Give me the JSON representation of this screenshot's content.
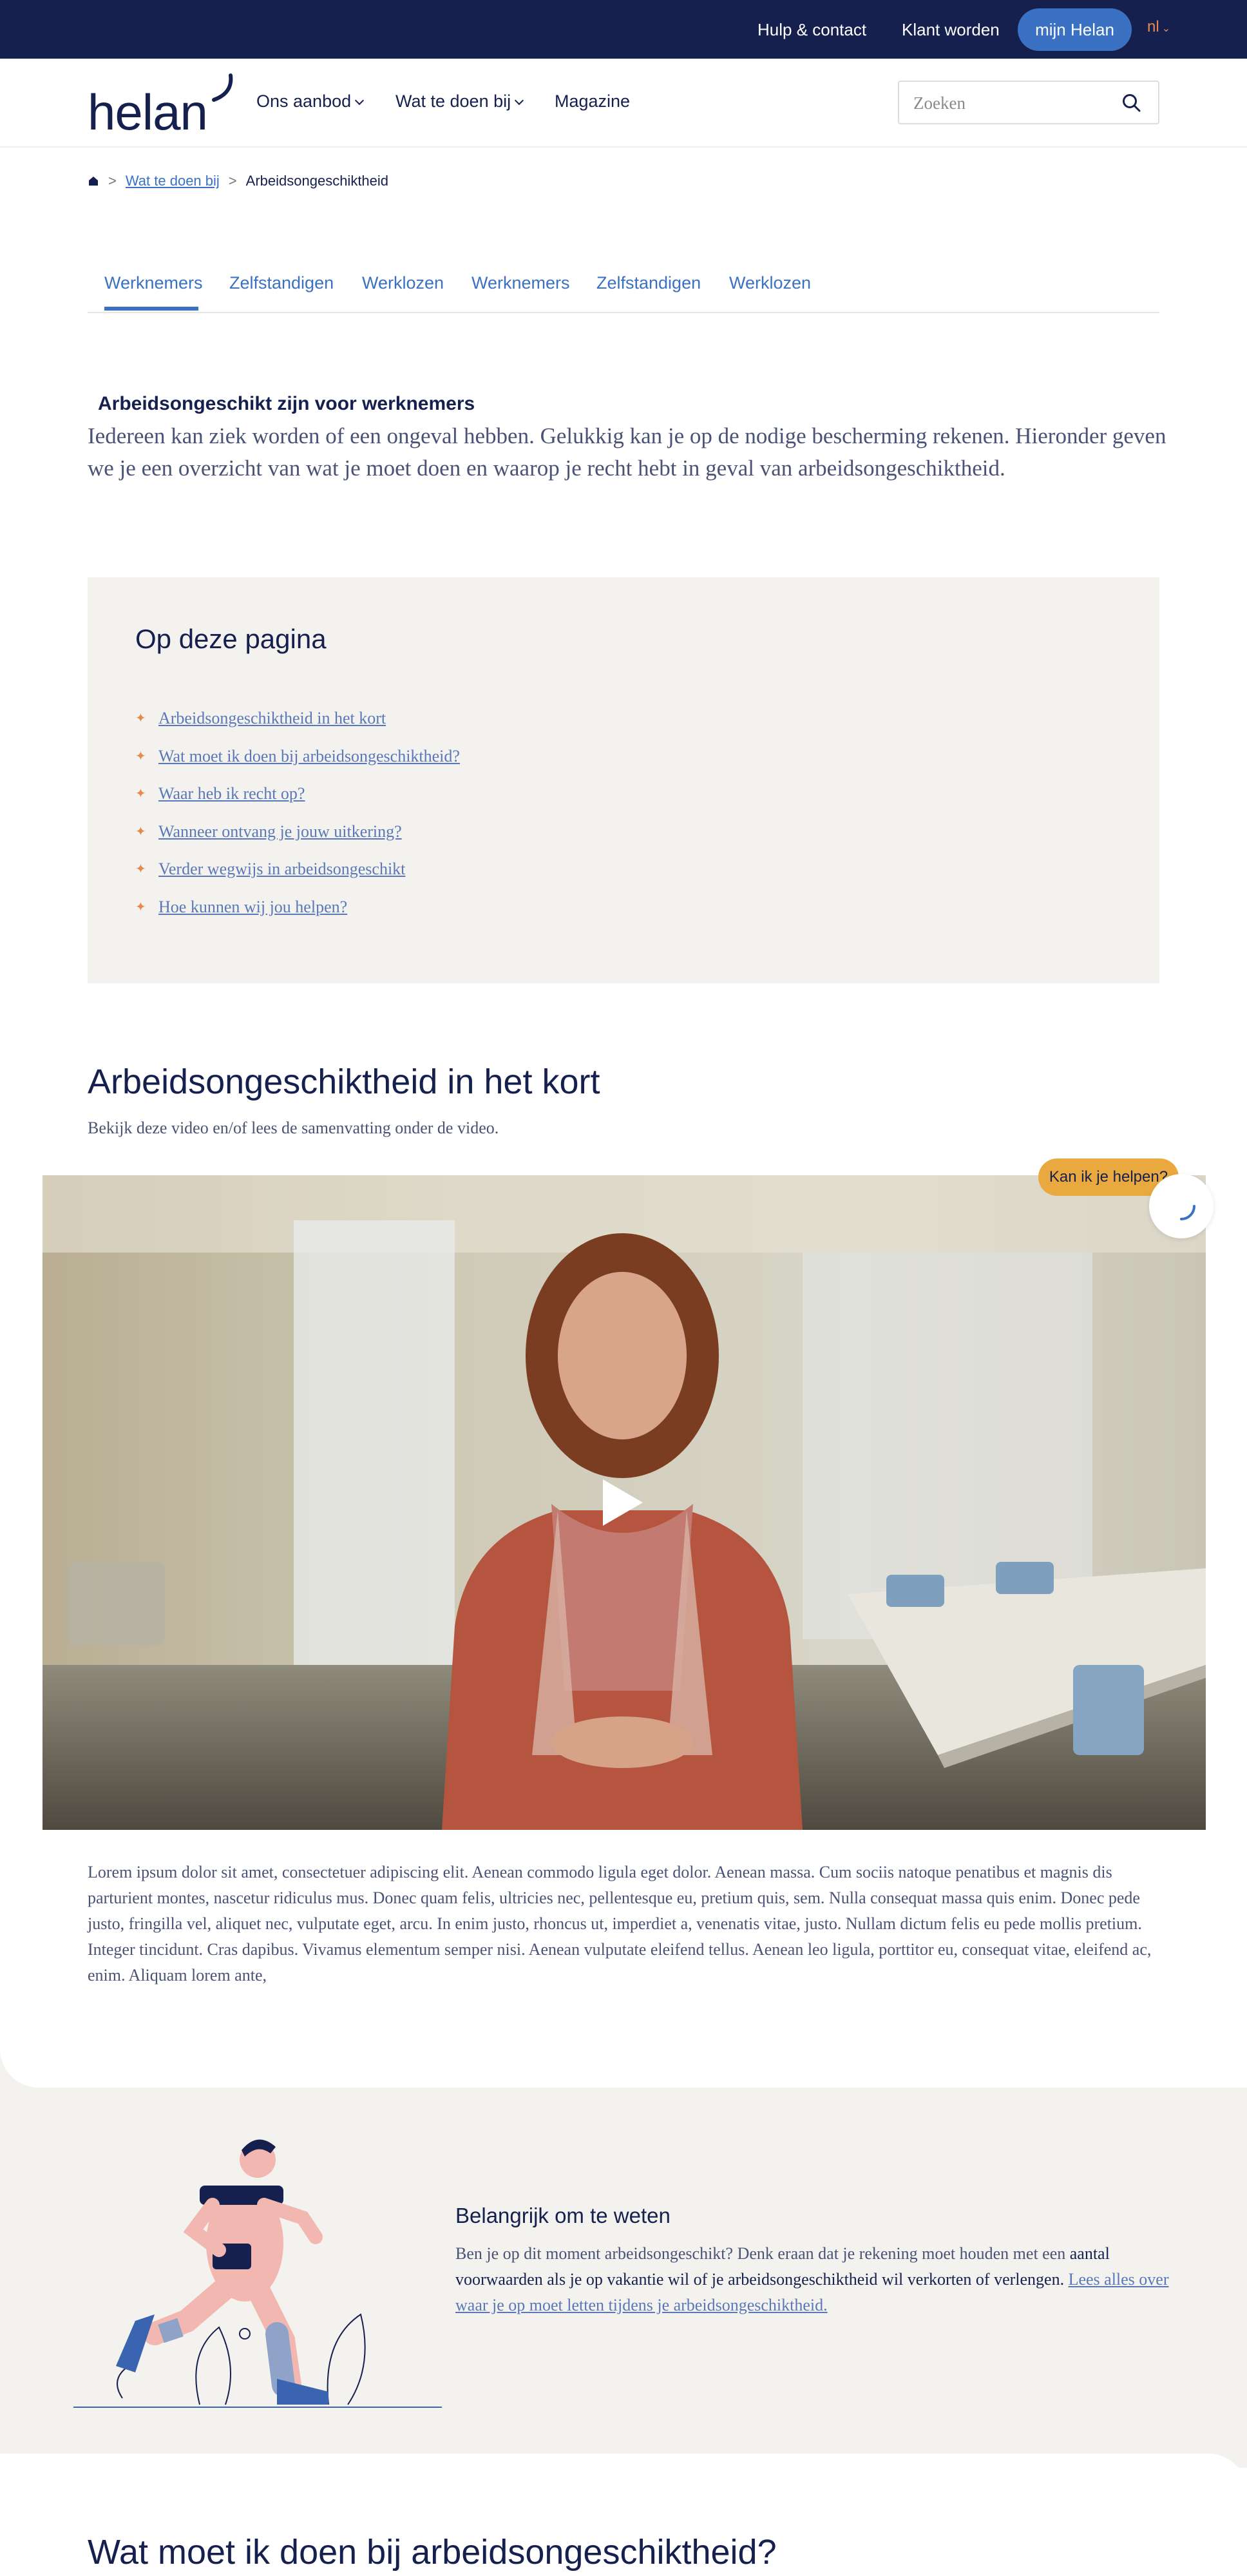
{
  "topbar": {
    "help_contact": "Hulp & contact",
    "become_client": "Klant worden",
    "mijn_helan": "mijn Helan",
    "language": "nl"
  },
  "header": {
    "logo_text": "helan",
    "nav": [
      {
        "label": "Ons aanbod"
      },
      {
        "label": "Wat te doen bij"
      },
      {
        "label": "Magazine"
      }
    ],
    "search_placeholder": "Zoeken"
  },
  "breadcrumb": {
    "items": [
      "Wat te doen bij",
      "Arbeidsongeschiktheid"
    ]
  },
  "tabs": [
    "Werknemers",
    "Zelfstandigen",
    "Werklozen",
    "Werknemers",
    "Zelfstandigen",
    "Werklozen"
  ],
  "intro": {
    "title": "Arbeidsongeschikt zijn voor werknemers",
    "text": "Iedereen kan ziek worden of een ongeval hebben. Gelukkig kan je op de nodige bescherming rekenen. Hieronder geven we je een overzicht van wat je moet doen en waarop je recht hebt in geval van arbeidsongeschiktheid."
  },
  "toc": {
    "title": "Op deze pagina",
    "items": [
      "Arbeidsongeschiktheid in het kort",
      "Wat moet ik doen bij arbeidsongeschiktheid?",
      "Waar heb ik recht op?",
      "Wanneer ontvang je jouw uitkering?",
      "Verder wegwijs in arbeidsongeschikt",
      "Hoe kunnen wij jou helpen?"
    ]
  },
  "section": {
    "title": "Arbeidsongeschiktheid in het kort",
    "subtitle": "Bekijk deze video en/of lees de samenvatting onder de video."
  },
  "help_bubble": "Kan ik je helpen?",
  "lorem": "Lorem ipsum dolor sit amet, consectetuer adipiscing elit. Aenean commodo ligula eget dolor. Aenean massa. Cum sociis natoque penatibus et magnis dis parturient montes, nascetur ridiculus mus. Donec quam felis, ultricies nec, pellentesque eu, pretium quis, sem. Nulla consequat massa quis enim. Donec pede justo, fringilla vel, aliquet nec, vulputate eget, arcu. In enim justo, rhoncus ut, imperdiet a, venenatis vitae, justo. Nullam dictum felis eu pede mollis pretium. Integer tincidunt. Cras dapibus. Vivamus elementum semper nisi. Aenean vulputate eleifend tellus. Aenean leo ligula, porttitor eu, consequat vitae, eleifend ac, enim. Aliquam lorem ante,",
  "important": {
    "title": "Belangrijk om te weten",
    "text_part1": "Ben je op dit moment arbeidsongeschikt? Denk eraan dat je rekening moet houden met een ",
    "text_strong": "aantal voorwaarden als je op vakantie wil of je arbeidsongeschiktheid wil verkorten of verlengen.",
    "link": "Lees alles over waar je op moet letten tijdens je arbeidsongeschiktheid."
  },
  "next_section_title": "Wat moet ik doen bij arbeidsongeschiktheid?"
}
